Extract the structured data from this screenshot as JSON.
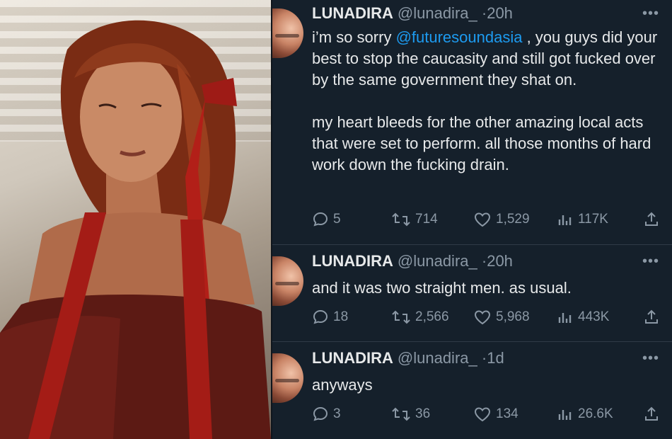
{
  "tweets": [
    {
      "name": "LUNADIRA",
      "handle": "@lunadira_",
      "time": "20h",
      "more": "•••",
      "text_parts": {
        "before": "i’m so sorry ",
        "mention": "@futuresoundasia",
        "after": " , you guys did your best to stop the caucasity and still got fucked over by the same government they shat on."
      },
      "paragraph2": "my heart bleeds for the other amazing local acts that were set to perform. all those months of hard work down the fucking drain.",
      "replies": "5",
      "retweets": "714",
      "likes": "1,529",
      "views": "117K"
    },
    {
      "name": "LUNADIRA",
      "handle": "@lunadira_",
      "time": "20h",
      "more": "•••",
      "text": "and it was two straight men. as usual.",
      "replies": "18",
      "retweets": "2,566",
      "likes": "5,968",
      "views": "443K"
    },
    {
      "name": "LUNADIRA",
      "handle": "@lunadira_",
      "time": "1d",
      "more": "•••",
      "text": "anyways",
      "replies": "3",
      "retweets": "36",
      "likes": "134",
      "views": "26.6K"
    }
  ],
  "separator": "·",
  "colors": {
    "background": "#15202b",
    "text": "#e7e9ea",
    "muted": "#8b98a5",
    "link": "#1d9bf0"
  }
}
